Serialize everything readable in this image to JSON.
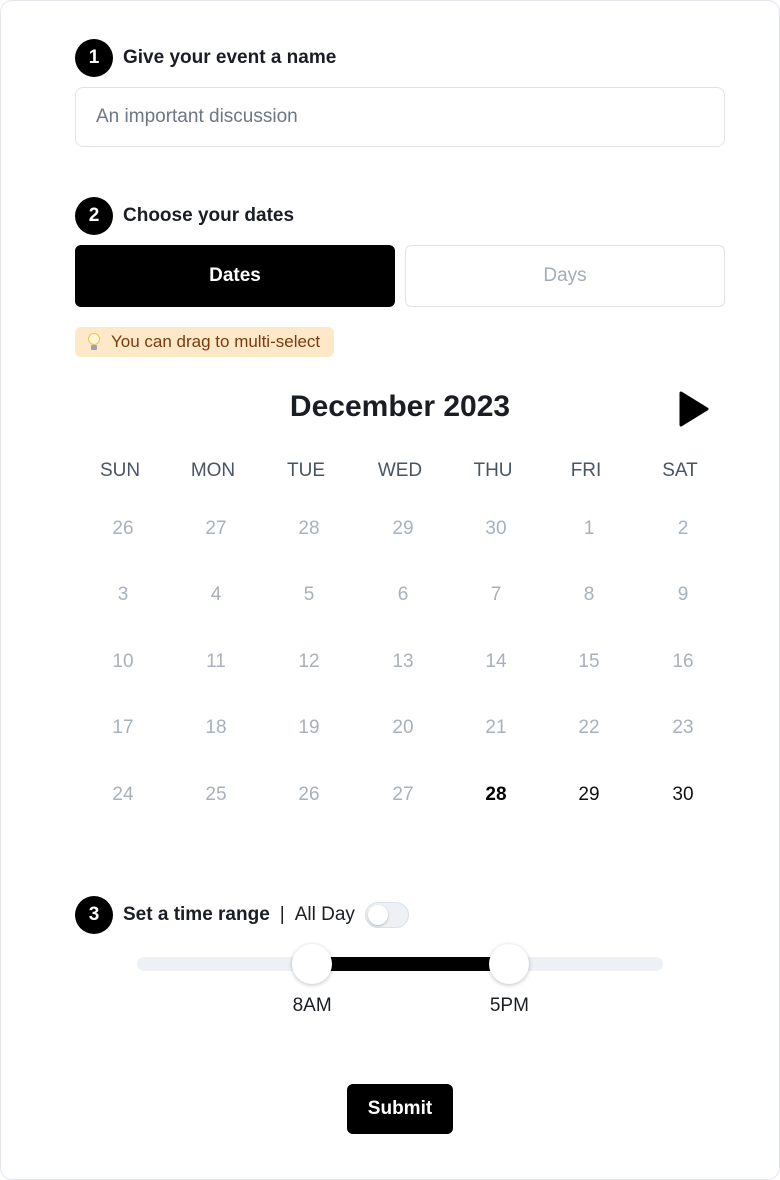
{
  "steps": {
    "name": {
      "number": "1",
      "title": "Give your event a name",
      "input_placeholder": "An important discussion",
      "input_value": ""
    },
    "dates": {
      "number": "2",
      "title": "Choose your dates",
      "tab_dates": "Dates",
      "tab_days": "Days",
      "active_tab": "Dates",
      "hint_icon": "lightbulb-icon",
      "hint": "You can drag to multi-select"
    },
    "time": {
      "number": "3",
      "title": "Set a time range",
      "separator": "|",
      "all_day_label": "All Day",
      "all_day_enabled": false
    }
  },
  "calendar": {
    "month_title": "December 2023",
    "next_icon": "play-arrow-icon",
    "weekdays": [
      "SUN",
      "MON",
      "TUE",
      "WED",
      "THU",
      "FRI",
      "SAT"
    ],
    "weeks": [
      [
        "26",
        "27",
        "28",
        "29",
        "30",
        "1",
        "2"
      ],
      [
        "3",
        "4",
        "5",
        "6",
        "7",
        "8",
        "9"
      ],
      [
        "10",
        "11",
        "12",
        "13",
        "14",
        "15",
        "16"
      ],
      [
        "17",
        "18",
        "19",
        "20",
        "21",
        "22",
        "23"
      ],
      [
        "24",
        "25",
        "26",
        "27",
        "28",
        "29",
        "30"
      ]
    ],
    "today": "28",
    "selectable_days": [
      "28",
      "29",
      "30"
    ]
  },
  "time_range": {
    "start_label": "8AM",
    "end_label": "5PM",
    "start_fraction": 0.333,
    "end_fraction": 0.708
  },
  "submit_label": "Submit",
  "colors": {
    "primary": "#000000",
    "muted_day": "#a7b1bc",
    "hint_bg": "#fde9c8",
    "hint_text": "#7a3a10",
    "track": "#edf1f5"
  }
}
